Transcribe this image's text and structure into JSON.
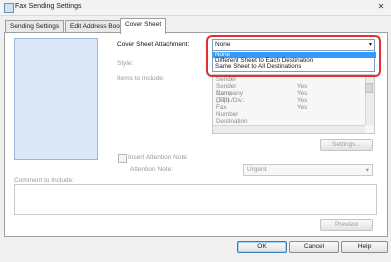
{
  "window": {
    "title": "Fax Sending Settings",
    "close_glyph": "✕"
  },
  "tabs": [
    "Sending Settings",
    "Edit Address Book",
    "Cover Sheet"
  ],
  "cover_sheet": {
    "attachment_label": "Cover Sheet Attachment:",
    "attachment_value": "None",
    "attachment_options": [
      "None",
      "Different Sheet to Each Destination",
      "Same Sheet to All Destinations"
    ],
    "style_label": "Style:",
    "items_label": "Items to Include:",
    "items": [
      {
        "name": "Sender",
        "value": ""
      },
      {
        "name": "Sender Name (TTI)",
        "value": "Yes"
      },
      {
        "name": "Company",
        "value": "Yes"
      },
      {
        "name": "Dept./Div.:",
        "value": "Yes"
      },
      {
        "name": "Fax Number",
        "value": "Yes"
      },
      {
        "name": "",
        "value": ""
      },
      {
        "name": "Destination",
        "value": ""
      }
    ],
    "settings_button": "Settings...",
    "insert_note_label": "Insert Attention Note",
    "attention_note_label": "Attention Note:",
    "attention_note_value": "Urgent",
    "comment_label": "Comment to Include:",
    "preview_button": "Preview"
  },
  "footer": {
    "ok": "OK",
    "cancel": "Cancel",
    "help": "Help"
  },
  "icons": {
    "combo_arrow": "▾",
    "dropdown_arrow": "▾"
  },
  "colors": {
    "selection": "#3399ff",
    "highlight_outline": "#e03030"
  }
}
